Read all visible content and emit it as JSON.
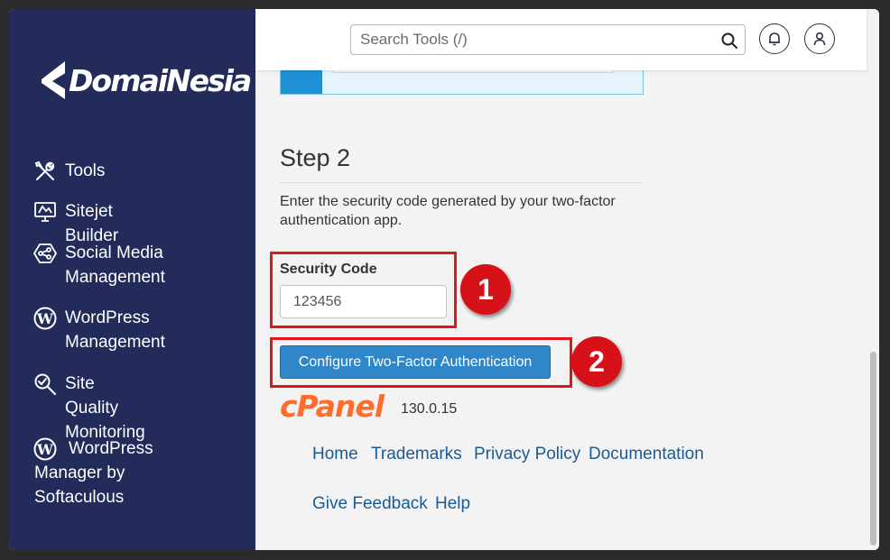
{
  "brand": {
    "name": "DomaiNesia"
  },
  "sidebar": {
    "items": [
      {
        "label": "Tools",
        "icon": "tools-icon"
      },
      {
        "label": "Sitejet Builder",
        "icon": "monitor-icon"
      },
      {
        "label": "Social Media\nManagement",
        "icon": "social-media-icon"
      },
      {
        "label": "WordPress\nManagement",
        "icon": "wordpress-icon"
      },
      {
        "label": "Site Quality\nMonitoring",
        "icon": "magnifier-icon"
      },
      {
        "label": "WordPress\nManager by\nSoftaculous",
        "icon": "wordpress-icon"
      }
    ]
  },
  "topbar": {
    "search_placeholder": "Search Tools (/)"
  },
  "step": {
    "title": "Step 2",
    "description": "Enter the security code generated by your two-factor authentication app."
  },
  "security_code": {
    "label": "Security Code",
    "value": "123456"
  },
  "configure_button": {
    "label": "Configure Two-Factor Authentication"
  },
  "annotations": {
    "badge_1": "1",
    "badge_2": "2",
    "highlight_color": "#e0161a"
  },
  "footer": {
    "logo_text": "cPanel",
    "version": "130.0.15",
    "links": [
      "Home",
      "Trademarks",
      "Privacy Policy",
      "Documentation",
      "Give Feedback",
      "Help"
    ]
  },
  "colors": {
    "sidebar": "#232b5a",
    "primary": "#2f86c8",
    "link": "#1a5a96",
    "cpanel": "#ff6c2c",
    "badge": "#d61218"
  }
}
